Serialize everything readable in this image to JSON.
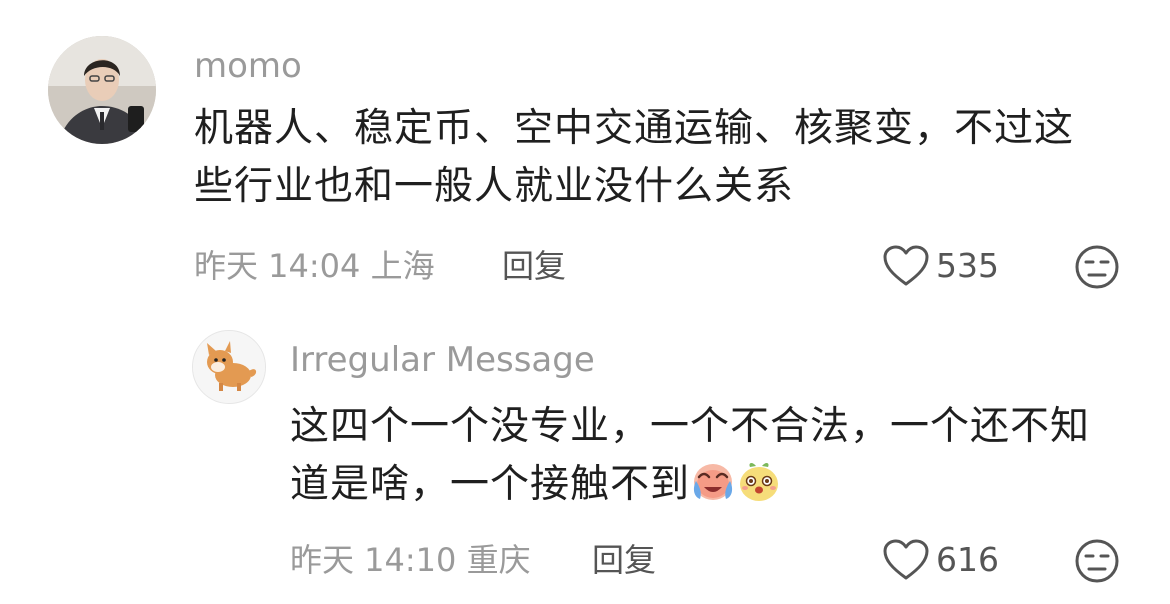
{
  "comments": [
    {
      "username": "momo",
      "text_line1": "机器人、稳定币、空中交通运输、核聚变，不过这",
      "text_line2": "些行业也和一般人就业没什么关系",
      "time": "昨天 14:04",
      "location": "上海",
      "reply_label": "回复",
      "likes": "535"
    },
    {
      "username": "Irregular Message",
      "text_line1": "这四个一个没专业，一个不合法，一个还不知",
      "text_line2": "道是啥，一个接触不到",
      "time": "昨天 14:10",
      "location": "重庆",
      "reply_label": "回复",
      "likes": "616",
      "emojis": [
        "crying-laughing-face",
        "surprised-pear-face"
      ]
    }
  ],
  "colors": {
    "username": "#9a9a9a",
    "text": "#1f1f1f",
    "meta": "#9a9a9a",
    "action": "#555555"
  }
}
